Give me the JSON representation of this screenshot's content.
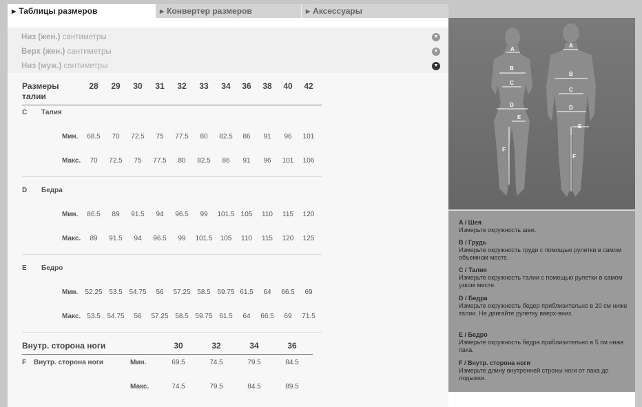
{
  "tabs": [
    {
      "label": "Таблицы размеров"
    },
    {
      "label": "Конвертер размеров"
    },
    {
      "label": "Аксессуары"
    }
  ],
  "accordions": [
    {
      "bold": "Низ (жен.)",
      "rest": " сантиметры"
    },
    {
      "bold": "Верх (жен.)",
      "rest": " сантиметры"
    },
    {
      "bold": "Низ (муж.)",
      "rest": " сантиметры"
    }
  ],
  "table": {
    "header_line1": "Размеры",
    "header_line2": "талии",
    "sizes": [
      "28",
      "29",
      "30",
      "31",
      "32",
      "33",
      "34",
      "36",
      "38",
      "40",
      "42"
    ],
    "min_label": "Мин.",
    "max_label": "Макс.",
    "groups": [
      {
        "letter": "C",
        "name": "Талия",
        "min": [
          "68.5",
          "70",
          "72.5",
          "75",
          "77.5",
          "80",
          "82.5",
          "86",
          "91",
          "96",
          "101"
        ],
        "max": [
          "70",
          "72.5",
          "75",
          "77.5",
          "80",
          "82.5",
          "86",
          "91",
          "96",
          "101",
          "106"
        ]
      },
      {
        "letter": "D",
        "name": "Бедра",
        "min": [
          "86.5",
          "89",
          "91.5",
          "94",
          "96.5",
          "99",
          "101.5",
          "105",
          "110",
          "115",
          "120"
        ],
        "max": [
          "89",
          "91.5",
          "94",
          "96.5",
          "99",
          "101.5",
          "105",
          "110",
          "115",
          "120",
          "125"
        ]
      },
      {
        "letter": "E",
        "name": "Бедро",
        "min": [
          "52.25",
          "53.5",
          "54.75",
          "56",
          "57.25",
          "58.5",
          "59.75",
          "61.5",
          "64",
          "66.5",
          "69"
        ],
        "max": [
          "53.5",
          "54.75",
          "56",
          "57.25",
          "58.5",
          "59.75",
          "61.5",
          "64",
          "66.5",
          "69",
          "71.5"
        ]
      }
    ],
    "inseam": {
      "header": "Внутр. сторона ноги",
      "sizes": [
        "30",
        "32",
        "34",
        "36"
      ],
      "letter": "F",
      "name": "Внутр. сторона ноги",
      "min": [
        "69.5",
        "74.5",
        "79.5",
        "84.5"
      ],
      "max": [
        "74.5",
        "79.5",
        "84.5",
        "89.5"
      ]
    }
  },
  "figure_labels": [
    "A",
    "B",
    "C",
    "D",
    "E",
    "F"
  ],
  "info": [
    {
      "title": "A / Шея",
      "text": "Измерьте окружность шеи."
    },
    {
      "title": "B / Грудь",
      "text": "Измерьте окружность груди с помощью рулетки в самом объемном месте."
    },
    {
      "title": "C / Талия",
      "text": "Измерьте окружность талии с помощью рулетки в самом узком месте."
    },
    {
      "title": "D / Бедра",
      "text": "Измерьте окружность бедер приблизительно в 20 см ниже талии. Не двигайте рулетку вверх-вниз."
    },
    {
      "title": "E / Бедро",
      "text": "Измерьте окружность бедра приблизительно в 5 см ниже паха."
    },
    {
      "title": "F / Внутр. сторона ноги",
      "text": "Измерьте длину внутренней строны ноги от паха до лодыжки."
    }
  ]
}
